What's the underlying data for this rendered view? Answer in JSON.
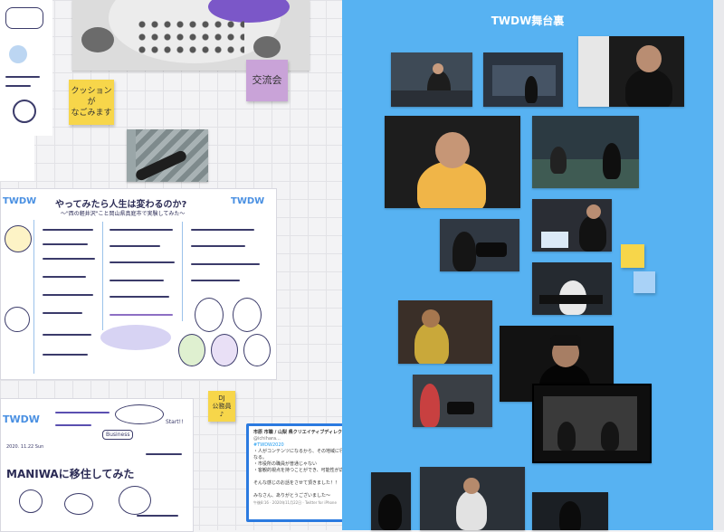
{
  "frame": {
    "title": "TWDW舞台裏"
  },
  "stickies": {
    "cushion": "クッションが\nなごみます",
    "koryukai": "交流会",
    "dj": "DJ\n公務員\n♪"
  },
  "sketch_poster": {
    "logo_left": "TWDW",
    "logo_right": "TWDW",
    "headline": "やってみたら人生は変わるのか?",
    "subtitle": "〜\"西の軽井沢\"こと岡山県真庭市で実験してみた〜"
  },
  "sketch_bottom": {
    "logo": "TWDW",
    "big_text": "MANIWAに移住してみた",
    "date": "2020. 11.22 Sun",
    "small_talk": "Start!!",
    "badge": "Business"
  },
  "tweet": {
    "account": "市原 市職 / 山梨 県クリエイティブディレクター (他)",
    "handle": "@ichihara...",
    "hashtag": "#TWDW2020",
    "body": "・人がコンテンツになるから、その地域に行きたくなる。\n・市役所の職員が普通じゃない\n・客観的視点を持つことができ、可能性が広がる\n\nそんな感じのお話をさせて頂きました！！\n\nみなさん、ありがとうございました〜",
    "meta": "午後8:16 · 2020年11月22日 · Twitter for iPhone"
  },
  "colors": {
    "frame_blue": "#57b2f2",
    "sticky_yellow": "#f7d64a",
    "sticky_purple": "#c9a3d8",
    "sticky_blue": "#a9d2f7"
  }
}
